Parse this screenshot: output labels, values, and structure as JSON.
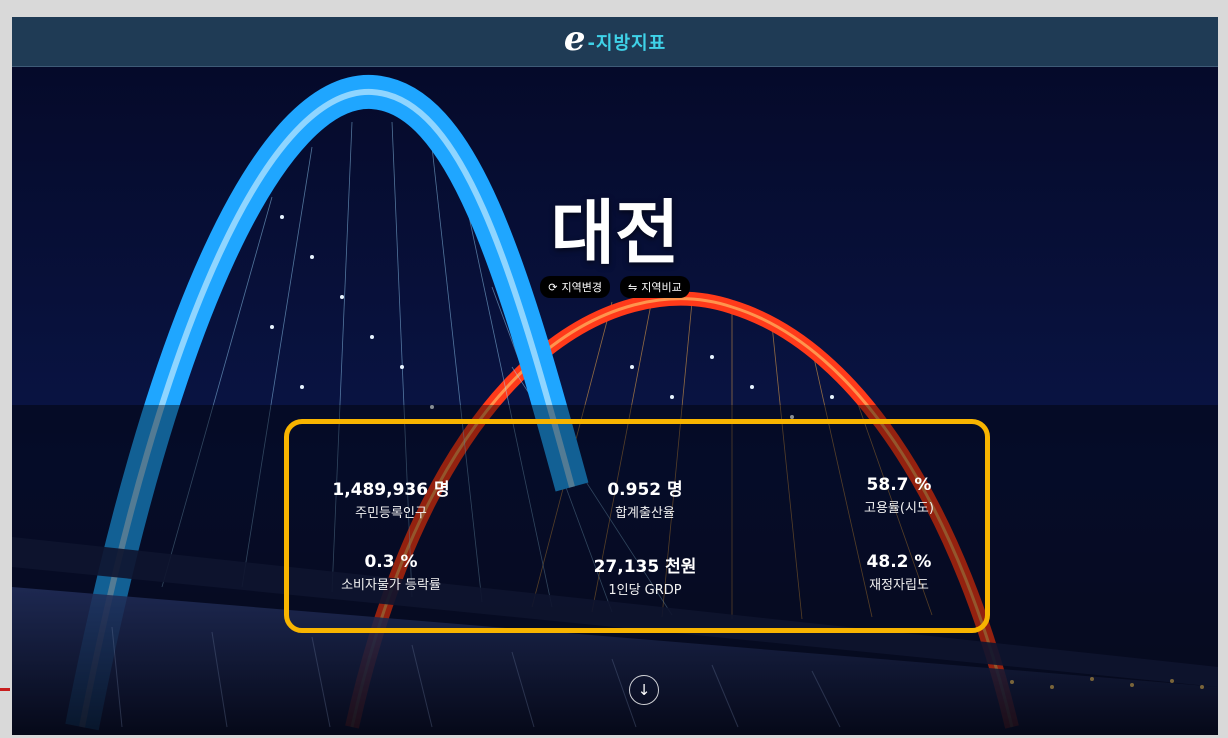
{
  "header": {
    "logo_e": "e",
    "logo_text": "-지방지표"
  },
  "region": {
    "name": "대전",
    "buttons": [
      {
        "icon": "⟳",
        "label": "지역변경"
      },
      {
        "icon": "⇋",
        "label": "지역비교"
      }
    ]
  },
  "stats": [
    {
      "value": "1,489,936 명",
      "label": "주민등록인구"
    },
    {
      "value": "0.952 명",
      "label": "합계출산율"
    },
    {
      "value": "58.7 %",
      "label": "고용률(시도)"
    },
    {
      "value": "0.3 %",
      "label": "소비자물가 등락률"
    },
    {
      "value": "27,135 천원",
      "label": "1인당 GRDP"
    },
    {
      "value": "48.2 %",
      "label": "재정자립도"
    }
  ],
  "scroll": {
    "icon": "↓"
  },
  "colors": {
    "header_bg": "#1f3b55",
    "logo_accent": "#3fd2e8",
    "highlight": "#f8b400",
    "bridge_blue": "#1fa6ff",
    "bridge_red": "#ff3a1a"
  },
  "icons": [
    "refresh-icon",
    "compare-icon",
    "arrow-down-icon"
  ]
}
